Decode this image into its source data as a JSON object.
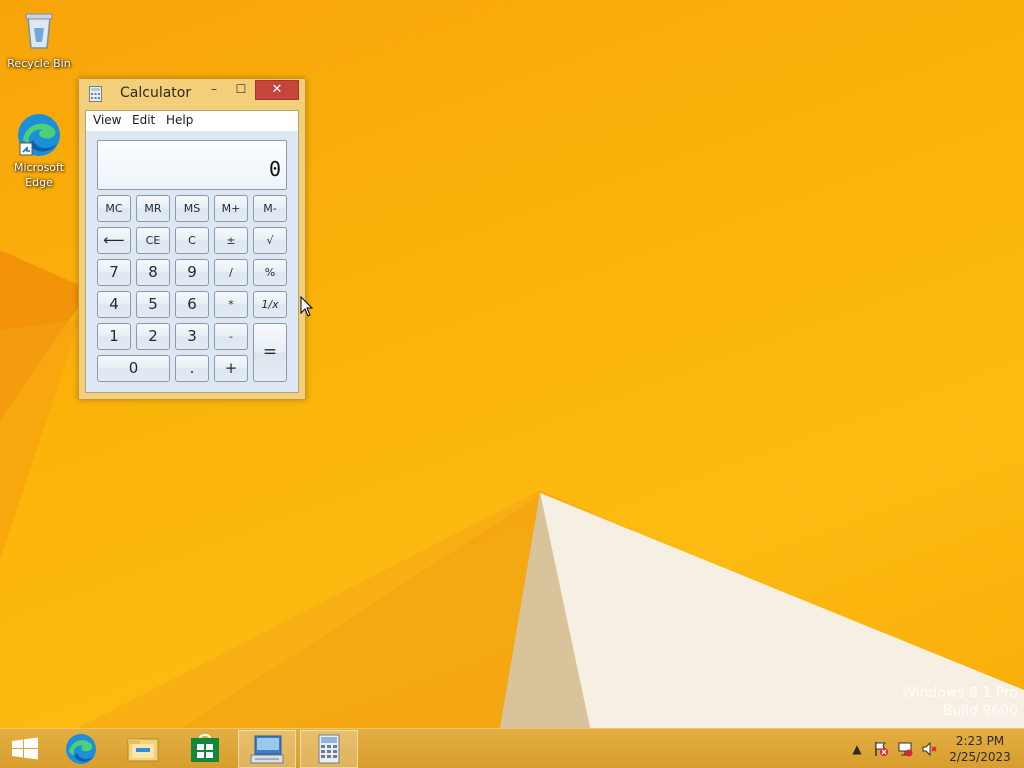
{
  "desktop": {
    "icons": [
      {
        "label": "Recycle Bin",
        "icon": "recycle-bin-icon"
      },
      {
        "label": "Microsoft Edge",
        "icon": "edge-icon"
      }
    ],
    "watermark": {
      "line1": "Windows 8.1 Pro",
      "line2": "Build 9600"
    }
  },
  "calculator": {
    "title": "Calculator",
    "title_buttons": {
      "minimize": "–",
      "maximize": "☐",
      "close": "✕"
    },
    "menu": [
      "View",
      "Edit",
      "Help"
    ],
    "display": "0",
    "keys": {
      "mc": "MC",
      "mr": "MR",
      "ms": "MS",
      "mplus": "M+",
      "mminus": "M-",
      "backspace": "⟵",
      "ce": "CE",
      "c": "C",
      "plusminus": "±",
      "sqrt": "√",
      "n7": "7",
      "n8": "8",
      "n9": "9",
      "divide": "/",
      "percent": "%",
      "n4": "4",
      "n5": "5",
      "n6": "6",
      "multiply": "*",
      "reciprocal": "1/x",
      "n1": "1",
      "n2": "2",
      "n3": "3",
      "minus": "-",
      "equals": "=",
      "n0": "0",
      "decimal": ".",
      "plus": "+"
    }
  },
  "taskbar": {
    "items": [
      {
        "icon": "start-icon"
      },
      {
        "icon": "edge-icon"
      },
      {
        "icon": "file-explorer-icon"
      },
      {
        "icon": "store-icon"
      },
      {
        "icon": "on-screen-keyboard-icon"
      },
      {
        "icon": "calculator-icon"
      }
    ],
    "tray": {
      "overflow": "▲",
      "time": "2:23 PM",
      "date": "2/25/2023"
    }
  },
  "colors": {
    "wallpaper": "#fbb40a",
    "window_frame": "#f4cf7a",
    "close_button": "#c7443c",
    "calc_body": "#dce8f4"
  }
}
